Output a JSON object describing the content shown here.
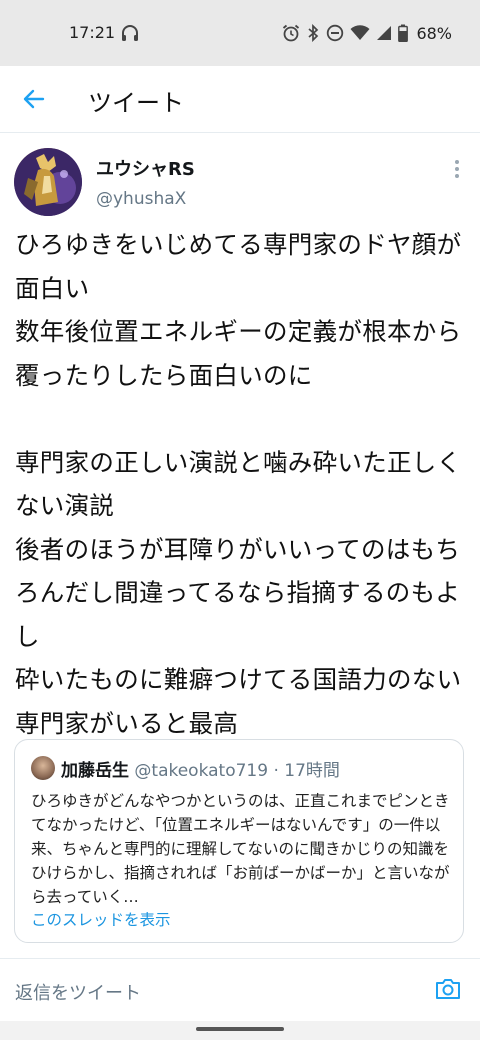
{
  "status_bar": {
    "time": "17:21",
    "battery": "68%",
    "icons": [
      "headset-icon",
      "alarm-icon",
      "bluetooth-icon",
      "dnd-icon",
      "wifi-icon",
      "signal-icon",
      "battery-icon"
    ]
  },
  "appbar": {
    "title": "ツイート",
    "accent_color": "#1da1f2"
  },
  "tweet": {
    "author_name": "ユウシャRS",
    "author_handle": "@yhushaX",
    "body": "ひろゆきをいじめてる専門家のドヤ顔が面白い\n数年後位置エネルギーの定義が根本から覆ったりしたら面白いのに\n\n専門家の正しい演説と噛み砕いた正しくない演説\n後者のほうが耳障りがいいってのはもちろんだし間違ってるなら指摘するのもよし\n砕いたものに難癖つけてる国語力のない専門家がいると最高"
  },
  "quote": {
    "author_name": "加藤岳生",
    "author_handle": "@takeokato719",
    "separator": " · ",
    "time": "17時間",
    "text": "ひろゆきがどんなやつかというのは、正直これまでピンときてなかったけど、「位置エネルギーはないんです」の一件以来、ちゃんと専門的に理解してないのに聞きかじりの知識をひけらかし、指摘されれば「お前ばーかばーか」と言いながら去っていく…",
    "thread_link": "このスレッドを表示"
  },
  "reply": {
    "placeholder": "返信をツイート"
  }
}
